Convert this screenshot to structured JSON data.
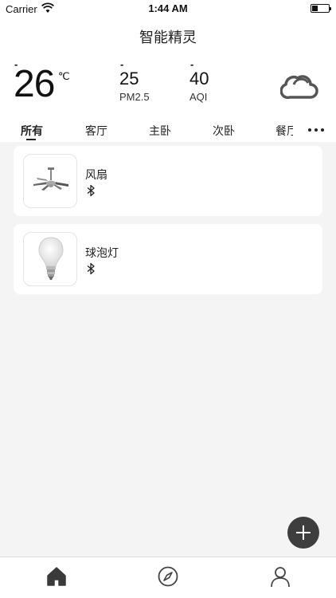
{
  "status_bar": {
    "carrier": "Carrier",
    "time": "1:44 AM"
  },
  "header": {
    "title": "智能精灵"
  },
  "weather": {
    "temperature": {
      "dash": "-",
      "value": "26",
      "unit": "℃"
    },
    "pm25": {
      "dash": "-",
      "value": "25",
      "label": "PM2.5"
    },
    "aqi": {
      "dash": "-",
      "value": "40",
      "label": "AQI"
    },
    "icon": "cloud-icon"
  },
  "tabs": [
    {
      "label": "所有",
      "active": true
    },
    {
      "label": "客厅",
      "active": false
    },
    {
      "label": "主卧",
      "active": false
    },
    {
      "label": "次卧",
      "active": false
    },
    {
      "label": "餐厅",
      "active": false
    }
  ],
  "devices": [
    {
      "name": "风扇",
      "image": "ceiling-fan",
      "connection": "bluetooth-icon"
    },
    {
      "name": "球泡灯",
      "image": "light-bulb",
      "connection": "bluetooth-icon"
    }
  ],
  "bottom_nav": [
    {
      "name": "home",
      "icon": "home-icon",
      "active": true
    },
    {
      "name": "discover",
      "icon": "compass-icon",
      "active": false
    },
    {
      "name": "profile",
      "icon": "person-icon",
      "active": false
    }
  ],
  "colors": {
    "background": "#f4f4f4",
    "card": "#ffffff",
    "text": "#111111",
    "fab": "#3e3e3e",
    "icon": "#444444"
  }
}
